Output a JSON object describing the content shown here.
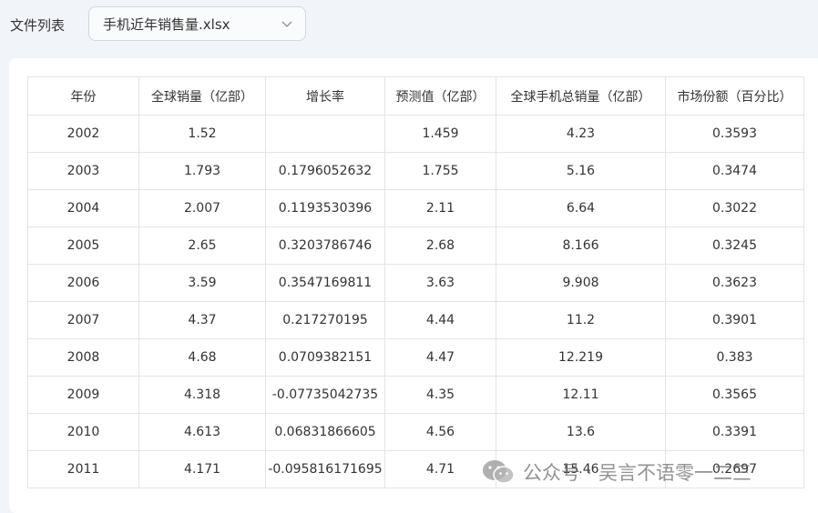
{
  "header": {
    "file_list_label": "文件列表",
    "selected_file": "手机近年销售量.xlsx"
  },
  "table": {
    "columns": [
      "年份",
      "全球销量（亿部）",
      "增长率",
      "预测值（亿部）",
      "全球手机总销量（亿部）",
      "市场份额（百分比）"
    ],
    "rows": [
      [
        "2002",
        "1.52",
        "",
        "1.459",
        "4.23",
        "0.3593"
      ],
      [
        "2003",
        "1.793",
        "0.1796052632",
        "1.755",
        "5.16",
        "0.3474"
      ],
      [
        "2004",
        "2.007",
        "0.1193530396",
        "2.11",
        "6.64",
        "0.3022"
      ],
      [
        "2005",
        "2.65",
        "0.3203786746",
        "2.68",
        "8.166",
        "0.3245"
      ],
      [
        "2006",
        "3.59",
        "0.3547169811",
        "3.63",
        "9.908",
        "0.3623"
      ],
      [
        "2007",
        "4.37",
        "0.217270195",
        "4.44",
        "11.2",
        "0.3901"
      ],
      [
        "2008",
        "4.68",
        "0.0709382151",
        "4.47",
        "12.219",
        "0.383"
      ],
      [
        "2009",
        "4.318",
        "-0.07735042735",
        "4.35",
        "12.11",
        "0.3565"
      ],
      [
        "2010",
        "4.613",
        "0.06831866605",
        "4.56",
        "13.6",
        "0.3391"
      ],
      [
        "2011",
        "4.171",
        "-0.095816171695",
        "4.71",
        "15.46",
        "0.2697"
      ]
    ]
  },
  "watermark": {
    "text": "公众号 · 吴言不语零一二三"
  },
  "icons": {
    "dropdown": "chevron-down-icon",
    "watermark_logo": "wechat-icon"
  }
}
